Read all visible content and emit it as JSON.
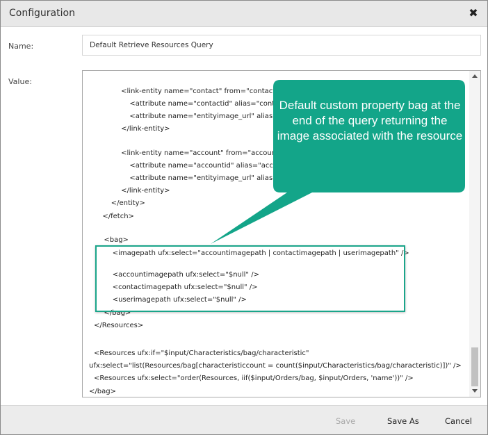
{
  "dialog": {
    "title": "Configuration",
    "close_glyph": "✖"
  },
  "fields": {
    "name_label": "Name:",
    "name_value": "Default Retrieve Resources Query",
    "value_label": "Value:"
  },
  "code_lines": [
    "      <link-entity name=\"contact\" from=\"contactid\" to",
    "        <attribute name=\"contactid\" alias=\"contactid\"",
    "        <attribute name=\"entityimage_url\" alias=\"cont",
    "      </link-entity>",
    "",
    "      <link-entity name=\"account\" from=\"accountid\" t",
    "        <attribute name=\"accountid\" alias=\"accountid\"",
    "        <attribute name=\"entityimage_url\" alias=\"accou",
    "      </link-entity>",
    "    </entity>",
    "  </fetch>",
    "",
    "  <bag>",
    "    <imagepath ufx:select=\"accountimagepath | contactimagepath | userimagepath\" />",
    "",
    "    <accountimagepath ufx:select=\"$null\" />",
    "    <contactimagepath ufx:select=\"$null\" />",
    "    <userimagepath ufx:select=\"$null\" />",
    "  </bag>",
    "</Resources>",
    "",
    "<Resources ufx:if=\"$input/Characteristics/bag/characteristic\"",
    "ufx:select=\"list(Resources/bag[characteristiccount = count($input/Characteristics/bag/characteristic)])\" />",
    "<Resources ufx:select=\"order(Resources, iif($input/Orders/bag, $input/Orders, 'name'))\" />",
    "</bag>"
  ],
  "callout": {
    "text": "Default custom property bag at the end of the query returning the image associated with the resource",
    "color": "#13a589"
  },
  "footer": {
    "save_label": "Save",
    "save_as_label": "Save As",
    "cancel_label": "Cancel"
  }
}
